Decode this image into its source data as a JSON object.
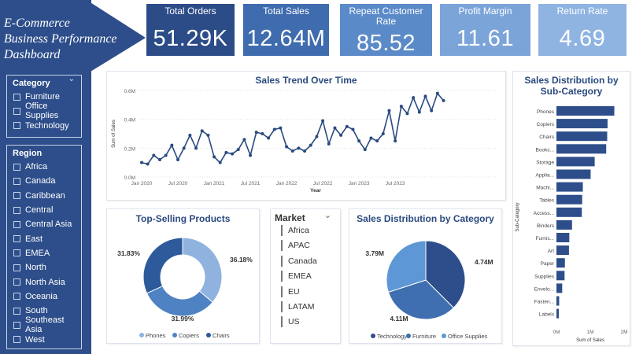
{
  "dashboard": {
    "title_lines": [
      "E-Commerce",
      "Business Performance",
      "Dashboard"
    ]
  },
  "colors": {
    "navy": "#2a4a7f",
    "sidebar": "#2d4e8a",
    "mid_blue": "#3f6fb0",
    "light_blue": "#8fb3de",
    "kpi_1": "#2c4c88",
    "kpi_2": "#3e6cae",
    "kpi_3": "#5b8ac8",
    "kpi_4": "#7ba4d9",
    "kpi_5": "#8fb4e2"
  },
  "category_slicer": {
    "title": "Category",
    "chevron_icon": "chevron-down-icon",
    "options": [
      "Furniture",
      "Office Supplies",
      "Technology"
    ]
  },
  "region_slicer": {
    "title": "Region",
    "chevron_icon": "chevron-down-icon",
    "options": [
      "Africa",
      "Canada",
      "Caribbean",
      "Central",
      "Central Asia",
      "East",
      "EMEA",
      "North",
      "North Asia",
      "Oceania",
      "South",
      "Southeast Asia",
      "West"
    ]
  },
  "market_slicer": {
    "title": "Market",
    "chevron_icon": "chevron-down-icon",
    "options": [
      "Africa",
      "APAC",
      "Canada",
      "EMEA",
      "EU",
      "LATAM",
      "US"
    ]
  },
  "kpis": [
    {
      "label": "Total Orders",
      "value": "51.29K"
    },
    {
      "label": "Total Sales",
      "value": "12.64M"
    },
    {
      "label": "Repeat Customer Rate",
      "value": "85.52"
    },
    {
      "label": "Profit Margin",
      "value": "11.61"
    },
    {
      "label": "Return Rate",
      "value": "4.69"
    }
  ],
  "chart_data": [
    {
      "type": "line",
      "title": "Sales Trend Over Time",
      "xlabel": "Year",
      "ylabel": "Sum of Sales",
      "x_ticks": [
        "Jan 2020",
        "Jul 2020",
        "Jan 2021",
        "Jul 2021",
        "Jan 2022",
        "Jul 2022",
        "Jan 2023",
        "Jul 2023"
      ],
      "y_ticks": [
        "0.0M",
        "0.2M",
        "0.4M",
        "0.6M"
      ],
      "ylim": [
        0,
        0.6
      ],
      "x": [
        "2020-01",
        "2020-02",
        "2020-03",
        "2020-04",
        "2020-05",
        "2020-06",
        "2020-07",
        "2020-08",
        "2020-09",
        "2020-10",
        "2020-11",
        "2020-12",
        "2021-01",
        "2021-02",
        "2021-03",
        "2021-04",
        "2021-05",
        "2021-06",
        "2021-07",
        "2021-08",
        "2021-09",
        "2021-10",
        "2021-11",
        "2021-12",
        "2022-01",
        "2022-02",
        "2022-03",
        "2022-04",
        "2022-05",
        "2022-06",
        "2022-07",
        "2022-08",
        "2022-09",
        "2022-10",
        "2022-11",
        "2022-12",
        "2023-01",
        "2023-02",
        "2023-03",
        "2023-04",
        "2023-05",
        "2023-06",
        "2023-07",
        "2023-08",
        "2023-09",
        "2023-10",
        "2023-11",
        "2023-12"
      ],
      "values": [
        0.1,
        0.09,
        0.15,
        0.12,
        0.15,
        0.22,
        0.12,
        0.2,
        0.29,
        0.2,
        0.32,
        0.29,
        0.14,
        0.1,
        0.17,
        0.16,
        0.19,
        0.26,
        0.15,
        0.31,
        0.3,
        0.27,
        0.33,
        0.34,
        0.21,
        0.18,
        0.2,
        0.18,
        0.22,
        0.28,
        0.39,
        0.23,
        0.34,
        0.29,
        0.35,
        0.33,
        0.25,
        0.19,
        0.27,
        0.25,
        0.3,
        0.46,
        0.25,
        0.49,
        0.44,
        0.55,
        0.45,
        0.56,
        0.46,
        0.58,
        0.53
      ]
    },
    {
      "type": "pie",
      "title": "Top-Selling Products",
      "donut": true,
      "slices": [
        {
          "name": "Phones",
          "value": 36.18,
          "label": "36.18%",
          "color": "#8fb3de"
        },
        {
          "name": "Copiers",
          "value": 31.99,
          "label": "31.99%",
          "color": "#4f82c3"
        },
        {
          "name": "Chairs",
          "value": 31.83,
          "label": "31.83%",
          "color": "#2c5a9a"
        }
      ],
      "legend": "bottom"
    },
    {
      "type": "pie",
      "title": "Sales Distribution by Category",
      "slices": [
        {
          "name": "Technology",
          "value": 4.74,
          "label": "4.74M",
          "color": "#2d4e8a"
        },
        {
          "name": "Furniture",
          "value": 4.11,
          "label": "4.11M",
          "color": "#3f6fb0"
        },
        {
          "name": "Office Supplies",
          "value": 3.79,
          "label": "3.79M",
          "color": "#5d97d6"
        }
      ],
      "legend": "bottom"
    },
    {
      "type": "bar",
      "orientation": "horizontal",
      "title": "Sales Distribution by Sub-Category",
      "xlabel": "Sum of Sales",
      "ylabel": "Sub-Category",
      "x_ticks": [
        "0M",
        "1M",
        "2M"
      ],
      "xlim": [
        0,
        2
      ],
      "categories": [
        "Phones",
        "Copiers",
        "Chairs",
        "Bookc...",
        "Storage",
        "Applia...",
        "Machi...",
        "Tables",
        "Access...",
        "Binders",
        "Furnis...",
        "Art",
        "Paper",
        "Supplies",
        "Envelo...",
        "Fasten...",
        "Labels"
      ],
      "values": [
        1.71,
        1.51,
        1.5,
        1.47,
        1.13,
        1.01,
        0.78,
        0.76,
        0.75,
        0.46,
        0.38,
        0.37,
        0.25,
        0.24,
        0.17,
        0.08,
        0.07
      ],
      "color": "#2d4e8a"
    }
  ]
}
